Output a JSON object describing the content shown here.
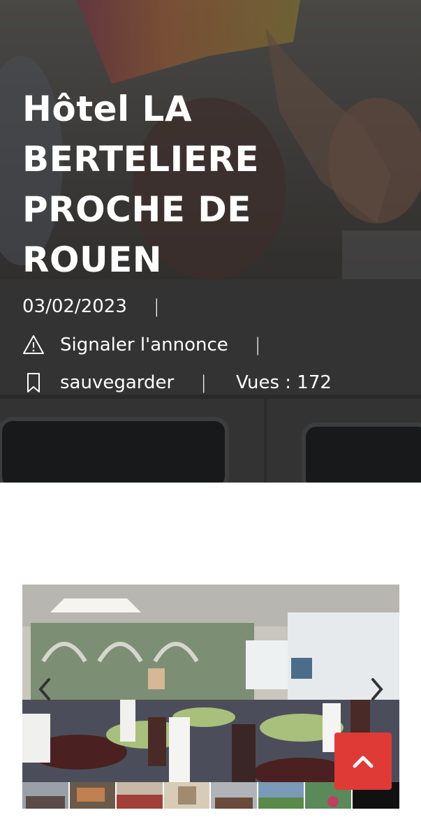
{
  "hero": {
    "title": "Hôtel LA BERTELIERE PROCHE DE ROUEN",
    "date": "03/02/2023",
    "separator": "|",
    "report_label": "Signaler l'annonce",
    "save_label": "sauvegarder",
    "views_label": "Vues : 172"
  },
  "gallery": {
    "thumbnail_count": 8
  },
  "colors": {
    "accent": "#e03a36",
    "hero_text": "#ffffff"
  },
  "icons": {
    "report": "warning-triangle-icon",
    "save": "bookmark-icon",
    "prev": "chevron-left-icon",
    "next": "chevron-right-icon",
    "back_to_top": "chevron-up-icon"
  }
}
